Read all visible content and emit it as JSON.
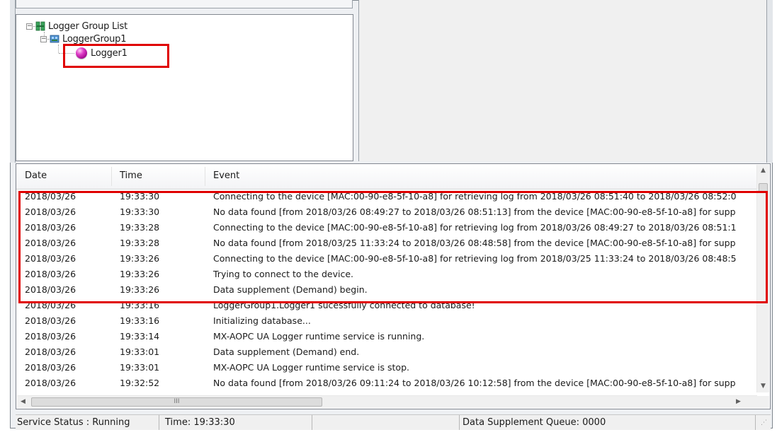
{
  "tree": {
    "root_label": "Logger Group List",
    "group_label": "LoggerGroup1",
    "logger_label": "Logger1"
  },
  "log": {
    "columns": {
      "date": "Date",
      "time": "Time",
      "event": "Event"
    },
    "rows": [
      {
        "date": "2018/03/26",
        "time": "19:33:30",
        "event": "Connecting to the device [MAC:00-90-e8-5f-10-a8] for retrieving log from 2018/03/26 08:51:40 to 2018/03/26 08:52:0"
      },
      {
        "date": "2018/03/26",
        "time": "19:33:30",
        "event": "No data found [from 2018/03/26 08:49:27 to 2018/03/26 08:51:13] from the device [MAC:00-90-e8-5f-10-a8] for supp"
      },
      {
        "date": "2018/03/26",
        "time": "19:33:28",
        "event": "Connecting to the device [MAC:00-90-e8-5f-10-a8] for retrieving log from 2018/03/26 08:49:27 to 2018/03/26 08:51:1"
      },
      {
        "date": "2018/03/26",
        "time": "19:33:28",
        "event": "No data found [from 2018/03/25 11:33:24 to 2018/03/26 08:48:58] from the device [MAC:00-90-e8-5f-10-a8] for supp"
      },
      {
        "date": "2018/03/26",
        "time": "19:33:26",
        "event": "Connecting to the device [MAC:00-90-e8-5f-10-a8] for retrieving log from 2018/03/25 11:33:24 to 2018/03/26 08:48:5"
      },
      {
        "date": "2018/03/26",
        "time": "19:33:26",
        "event": "Trying to connect to the device."
      },
      {
        "date": "2018/03/26",
        "time": "19:33:26",
        "event": "Data supplement (Demand) begin."
      },
      {
        "date": "2018/03/26",
        "time": "19:33:16",
        "event": "LoggerGroup1.Logger1 sucessfully connected to database!"
      },
      {
        "date": "2018/03/26",
        "time": "19:33:16",
        "event": "Initializing database..."
      },
      {
        "date": "2018/03/26",
        "time": "19:33:14",
        "event": "MX-AOPC UA Logger runtime service is running."
      },
      {
        "date": "2018/03/26",
        "time": "19:33:01",
        "event": "Data supplement (Demand) end."
      },
      {
        "date": "2018/03/26",
        "time": "19:33:01",
        "event": "MX-AOPC UA Logger runtime service is stop."
      },
      {
        "date": "2018/03/26",
        "time": "19:32:52",
        "event": "No data found [from 2018/03/26 09:11:24 to 2018/03/26 10:12:58] from the device [MAC:00-90-e8-5f-10-a8] for supp"
      }
    ],
    "hscroll_thumb_glyph": "III"
  },
  "statusbar": {
    "service_status": "Service Status : Running",
    "time": "Time: 19:33:30",
    "queue": "Data Supplement Queue: 0000"
  },
  "colors": {
    "highlight": "#e00000",
    "logger_icon": "#d22cc0"
  }
}
